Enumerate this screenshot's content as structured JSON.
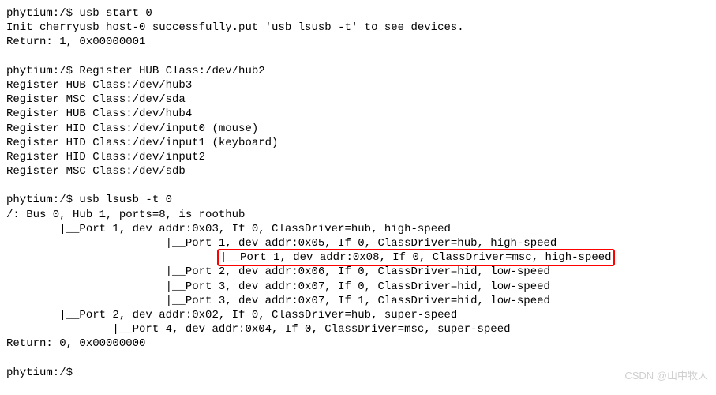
{
  "lines": {
    "l1": "phytium:/$ usb start 0",
    "l2": "Init cherryusb host-0 successfully.put 'usb lsusb -t' to see devices.",
    "l3": "Return: 1, 0x00000001",
    "l4": "",
    "l5": "phytium:/$ Register HUB Class:/dev/hub2",
    "l6": "Register HUB Class:/dev/hub3",
    "l7": "Register MSC Class:/dev/sda",
    "l8": "Register HUB Class:/dev/hub4",
    "l9": "Register HID Class:/dev/input0 (mouse)",
    "l10": "Register HID Class:/dev/input1 (keyboard)",
    "l11": "Register HID Class:/dev/input2",
    "l12": "Register MSC Class:/dev/sdb",
    "l13": "",
    "l14": "phytium:/$ usb lsusb -t 0",
    "l15": "/: Bus 0, Hub 1, ports=8, is roothub",
    "l16": "        |__Port 1, dev addr:0x03, If 0, ClassDriver=hub, high-speed",
    "l17": "                        |__Port 1, dev addr:0x05, If 0, ClassDriver=hub, high-speed",
    "l18_prefix": "                                ",
    "l18_box": "|__Port 1, dev addr:0x08, If 0, ClassDriver=msc, high-speed",
    "l19": "                        |__Port 2, dev addr:0x06, If 0, ClassDriver=hid, low-speed",
    "l20": "                        |__Port 3, dev addr:0x07, If 0, ClassDriver=hid, low-speed",
    "l21": "                        |__Port 3, dev addr:0x07, If 1, ClassDriver=hid, low-speed",
    "l22": "        |__Port 2, dev addr:0x02, If 0, ClassDriver=hub, super-speed",
    "l23": "                |__Port 4, dev addr:0x04, If 0, ClassDriver=msc, super-speed",
    "l24": "Return: 0, 0x00000000",
    "l25": "",
    "l26": "phytium:/$"
  },
  "watermark": "CSDN @山中牧人"
}
